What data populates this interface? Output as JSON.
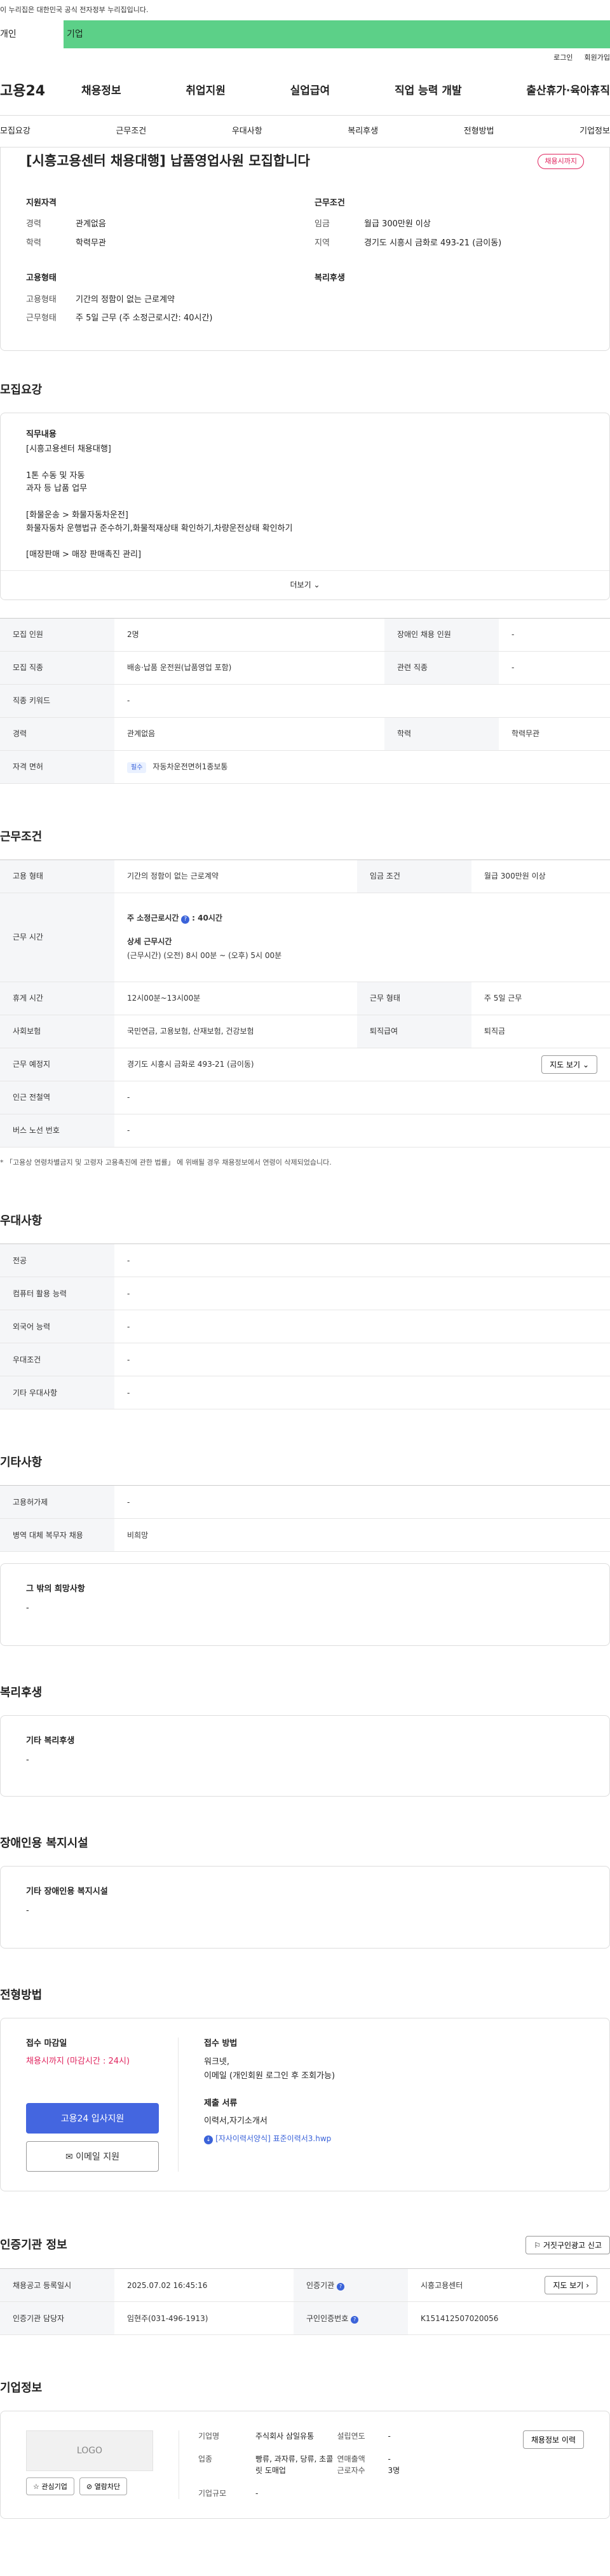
{
  "gov_banner": "이 누리집은 대한민국 공식 전자정부 누리집입니다.",
  "tabs": {
    "person": "개인",
    "company": "기업"
  },
  "util": {
    "login": "로그인",
    "join": "회원가입"
  },
  "gnb": {
    "logo": "고용24",
    "menu": [
      "채용정보",
      "취업지원",
      "실업급여",
      "직업 능력 개발",
      "출산휴가·육아휴직"
    ]
  },
  "subtabs": [
    "모집요강",
    "근무조건",
    "우대사항",
    "복리후생",
    "전형방법",
    "기업정보"
  ],
  "summary": {
    "title": "[시흥고용센터 채용대행] 납품영업사원 모집합니다",
    "badge": "채용시까지",
    "qual_title": "지원자격",
    "qual": [
      [
        "경력",
        "관계없음"
      ],
      [
        "학력",
        "학력무관"
      ]
    ],
    "cond_title": "근무조건",
    "cond": [
      [
        "임금",
        "월급 300만원 이상"
      ],
      [
        "지역",
        "경기도 시흥시 금화로 493-21 (금이동)"
      ]
    ],
    "emp_title": "고용형태",
    "emp": [
      [
        "고용형태",
        "기간의 정함이 없는 근로계약"
      ],
      [
        "근무형태",
        "주 5일 근무 (주 소정근로시간: 40시간)"
      ]
    ],
    "welfare_title": "복리후생"
  },
  "recruit": {
    "section": "모집요강",
    "desc_title": "직무내용",
    "desc_lines": [
      "[시흥고용센터 채용대행]",
      "",
      "1톤 수동 및 자동",
      "과자 등 납품 업무",
      "",
      "[화물운송 > 화물자동차운전]",
      "화물자동차 운행법규 준수하기,화물적재상태 확인하기,차량운전상태 확인하기",
      "",
      "[매장판매 > 매장 판매촉진 관리]"
    ],
    "more": "더보기",
    "table": {
      "count_k": "모집 인원",
      "count_v": "2명",
      "disabled_k": "장애인 채용 인원",
      "disabled_v": "-",
      "job_k": "모집 직종",
      "job_v": "배송·납품 운전원(납품영업 포함)",
      "related_k": "관련 직종",
      "related_v": "-",
      "kw_k": "직종 키워드",
      "kw_v": "-",
      "career_k": "경력",
      "career_v": "관계없음",
      "edu_k": "학력",
      "edu_v": "학력무관",
      "license_k": "자격 면허",
      "license_tag": "필수",
      "license_v": "자동차운전면허1종보통"
    }
  },
  "work": {
    "section": "근무조건",
    "emp_k": "고용 형태",
    "emp_v": "기간의 정함이 없는 근로계약",
    "wage_k": "임금 조건",
    "wage_v": "월급 300만원 이상",
    "time_k": "근무 시간",
    "time_week": "주 소정근로시간",
    "time_week_v": ": 40시간",
    "time_detail_t": "상세 근무시간",
    "time_detail": "(근무시간) (오전) 8시 00분 ~ (오후) 5시 00분",
    "rest_k": "휴게 시간",
    "rest_v": "12시00분~13시00분",
    "shape_k": "근무 형태",
    "shape_v": "주 5일 근무",
    "ins_k": "사회보험",
    "ins_v": "국민연금, 고용보험, 산재보험, 건강보험",
    "ret_k": "퇴직급여",
    "ret_v": "퇴직금",
    "place_k": "근무 예정지",
    "place_v": "경기도 시흥시 금화로 493-21 (금이동)",
    "map_btn": "지도 보기",
    "station_k": "인근 전철역",
    "station_v": "-",
    "bus_k": "버스 노선 번호",
    "bus_v": "-",
    "note": "* 「고용상 연령차별금지 및 고령자 고용촉진에 관한 법률」 에 위배될 경우 채용정보에서 연령이 삭제되었습니다."
  },
  "pref": {
    "section": "우대사항",
    "rows": [
      [
        "전공",
        "-"
      ],
      [
        "컴퓨터 활용 능력",
        "-"
      ],
      [
        "외국어 능력",
        "-"
      ],
      [
        "우대조건",
        "-"
      ],
      [
        "기타 우대사항",
        "-"
      ]
    ]
  },
  "etc": {
    "section": "기타사항",
    "rows": [
      [
        "고용허가제",
        "-"
      ],
      [
        "병역 대체 복무자 채용",
        "비희망"
      ]
    ],
    "other_title": "그 밖의 희망사항",
    "other_v": "-"
  },
  "welfare": {
    "section": "복리후생",
    "title": "기타 복리후생",
    "value": "-"
  },
  "disabled": {
    "section": "장애인용 복지시설",
    "title": "기타 장애인용 복지시설",
    "value": "-"
  },
  "apply": {
    "section": "전형방법",
    "deadline_t": "접수 마감일",
    "deadline_v": "채용시까지 (마감시간 : 24시)",
    "btn_apply": "고용24 입사지원",
    "btn_email": "이메일 지원",
    "method_t": "접수 방법",
    "method_v1": "워크넷,",
    "method_v2": "이메일 (개인회원 로그인 후 조회가능)",
    "docs_t": "제출 서류",
    "docs_v": "이력서,자기소개서",
    "file": "[자사이력서양식] 표준이력서3.hwp"
  },
  "agency": {
    "section": "인증기관 정보",
    "report_btn": "거짓구인광고 신고",
    "reg_k": "채용공고 등록일시",
    "reg_v": "2025.07.02 16:45:16",
    "org_k": "인증기관",
    "org_v": "시흥고용센터",
    "map_btn": "지도 보기",
    "mgr_k": "인증기관 담당자",
    "mgr_v": "임현주(031-496-1913)",
    "num_k": "구인인증번호",
    "num_v": "K151412507020056"
  },
  "company": {
    "section": "기업정보",
    "logo": "LOGO",
    "fav_btn": "관심기업",
    "block_btn": "열람차단",
    "name_k": "기업명",
    "name_v": "주식회사 삼일유통",
    "founded_k": "설립연도",
    "founded_v": "-",
    "biz_k": "업종",
    "biz_v": "빵류, 과자류, 당류, 초콜릿 도매업",
    "sales_k": "연매출액",
    "sales_v": "-",
    "emp_k": "근로자수",
    "emp_v": "3명",
    "size_k": "기업규모",
    "size_v": "-",
    "history_btn": "채용정보 이력"
  }
}
